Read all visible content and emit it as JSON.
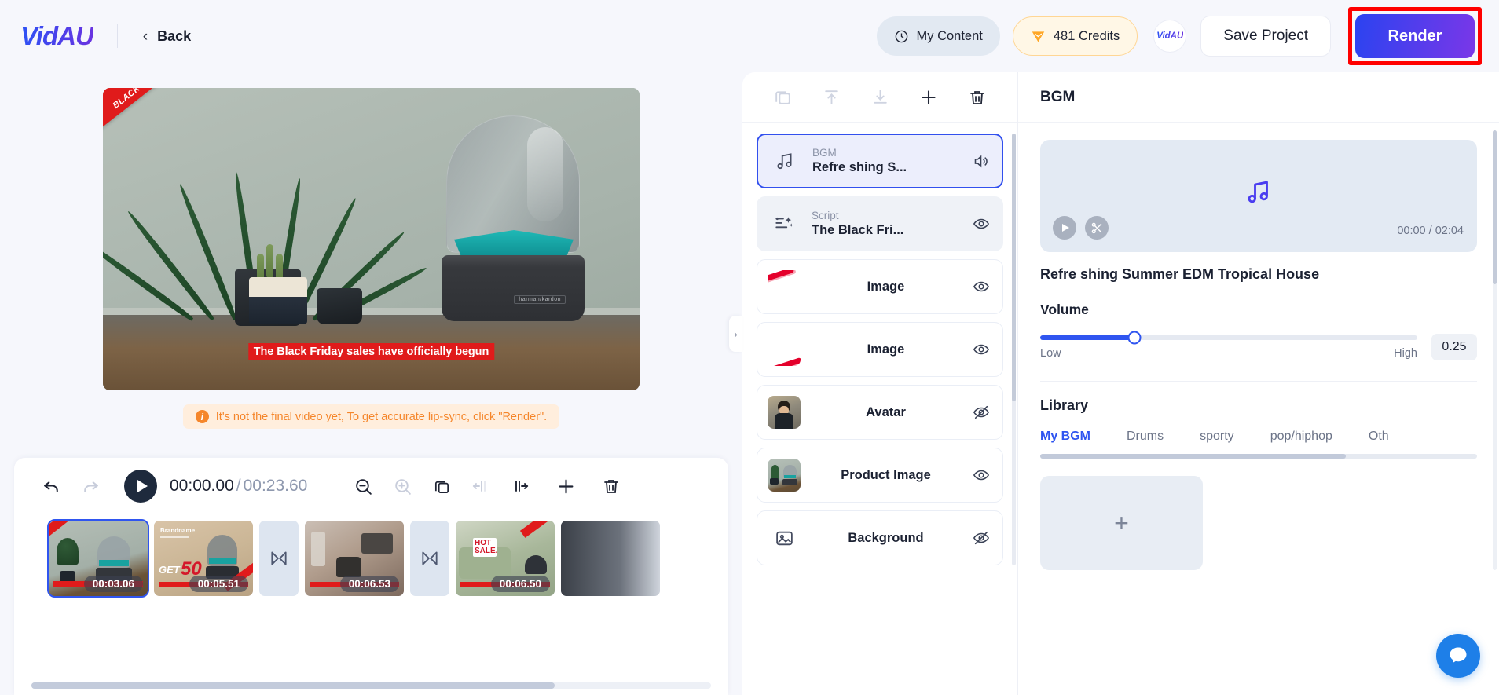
{
  "header": {
    "logo": "VidAU",
    "back_label": "Back",
    "my_content_label": "My Content",
    "credits_label": "481 Credits",
    "mini_logo": "VidAU",
    "save_label": "Save Project",
    "render_label": "Render",
    "clock_icon": "clock-icon",
    "gem_icon": "gem-icon"
  },
  "preview": {
    "caption": "The Black Friday sales have officially begun",
    "corner_badge": "BLACK FRIDAY",
    "speaker_brand": "harman/kardon",
    "warning": "It's not the final video yet, To get accurate lip-sync, click \"Render\".",
    "warning_icon": "info-icon"
  },
  "timeline": {
    "undo_icon": "undo-icon",
    "redo_icon": "redo-icon",
    "play_icon": "play-icon",
    "current_time": "00:00.00",
    "separator": "/",
    "total_time": "00:23.60",
    "tools": [
      {
        "name": "zoom-out-icon",
        "disabled": false
      },
      {
        "name": "zoom-in-icon",
        "disabled": true
      },
      {
        "name": "duplicate-icon",
        "disabled": false
      },
      {
        "name": "split-left-icon",
        "disabled": true
      },
      {
        "name": "split-right-icon",
        "disabled": false
      },
      {
        "name": "add-icon",
        "disabled": false
      },
      {
        "name": "delete-icon",
        "disabled": false
      }
    ],
    "clips": [
      {
        "duration": "00:03.06",
        "selected": true,
        "kind": "speaker-scene"
      },
      {
        "duration": "00:05.51",
        "selected": false,
        "kind": "get50-scene"
      },
      {
        "duration": "00:06.53",
        "selected": false,
        "kind": "kitchen-scene"
      },
      {
        "duration": "00:06.50",
        "selected": false,
        "kind": "hotsale-scene"
      }
    ],
    "transition_icon": "transition-icon"
  },
  "layers": {
    "toolbar": [
      {
        "name": "duplicate-layer-icon",
        "active": false
      },
      {
        "name": "move-up-icon",
        "active": false
      },
      {
        "name": "move-down-icon",
        "active": false
      },
      {
        "name": "add-layer-icon",
        "active": true
      },
      {
        "name": "delete-layer-icon",
        "active": true
      }
    ],
    "items": [
      {
        "sub": "BGM",
        "title": "Refre shing S...",
        "icon": "music-note-icon",
        "state_icon": "volume-icon",
        "active": true,
        "thumb": "none"
      },
      {
        "sub": "Script",
        "title": "The Black Fri...",
        "icon": "script-icon",
        "state_icon": "eye-icon",
        "active": false,
        "thumb": "none"
      },
      {
        "sub": "",
        "title": "Image",
        "icon": "none",
        "state_icon": "eye-icon",
        "active": false,
        "thumb": "red-slash"
      },
      {
        "sub": "",
        "title": "Image",
        "icon": "none",
        "state_icon": "eye-icon",
        "active": false,
        "thumb": "red-slash"
      },
      {
        "sub": "",
        "title": "Avatar",
        "icon": "none",
        "state_icon": "eye-off-icon",
        "active": false,
        "thumb": "avatar-photo"
      },
      {
        "sub": "",
        "title": "Product Image",
        "icon": "none",
        "state_icon": "eye-icon",
        "active": false,
        "thumb": "product-photo"
      },
      {
        "sub": "",
        "title": "Background",
        "icon": "image-icon",
        "state_icon": "eye-off-icon",
        "active": false,
        "thumb": "none"
      }
    ],
    "collapse_icon": "chevron-right-icon"
  },
  "bgm": {
    "panel_title": "BGM",
    "note_icon": "music-note-icon",
    "play_icon": "play-icon",
    "cut_icon": "scissors-icon",
    "time": "00:00 / 02:04",
    "track_title": "Refre shing Summer EDM Tropical House",
    "volume_label": "Volume",
    "volume_value": "0.25",
    "volume_percent": 25,
    "volume_low": "Low",
    "volume_high": "High",
    "library_label": "Library",
    "tabs": [
      {
        "label": "My BGM",
        "active": true
      },
      {
        "label": "Drums",
        "active": false
      },
      {
        "label": "sporty",
        "active": false
      },
      {
        "label": "pop/hiphop",
        "active": false
      },
      {
        "label": "Oth",
        "active": false
      }
    ],
    "add_label": "+",
    "chat_icon": "chat-icon"
  },
  "colors": {
    "accent": "#2f55f0",
    "purple": "#6a32e0",
    "orange": "#f5862b",
    "red_highlight": "#ff0000",
    "caption_red": "#e01b1b",
    "credit_gold": "#ffa726"
  }
}
